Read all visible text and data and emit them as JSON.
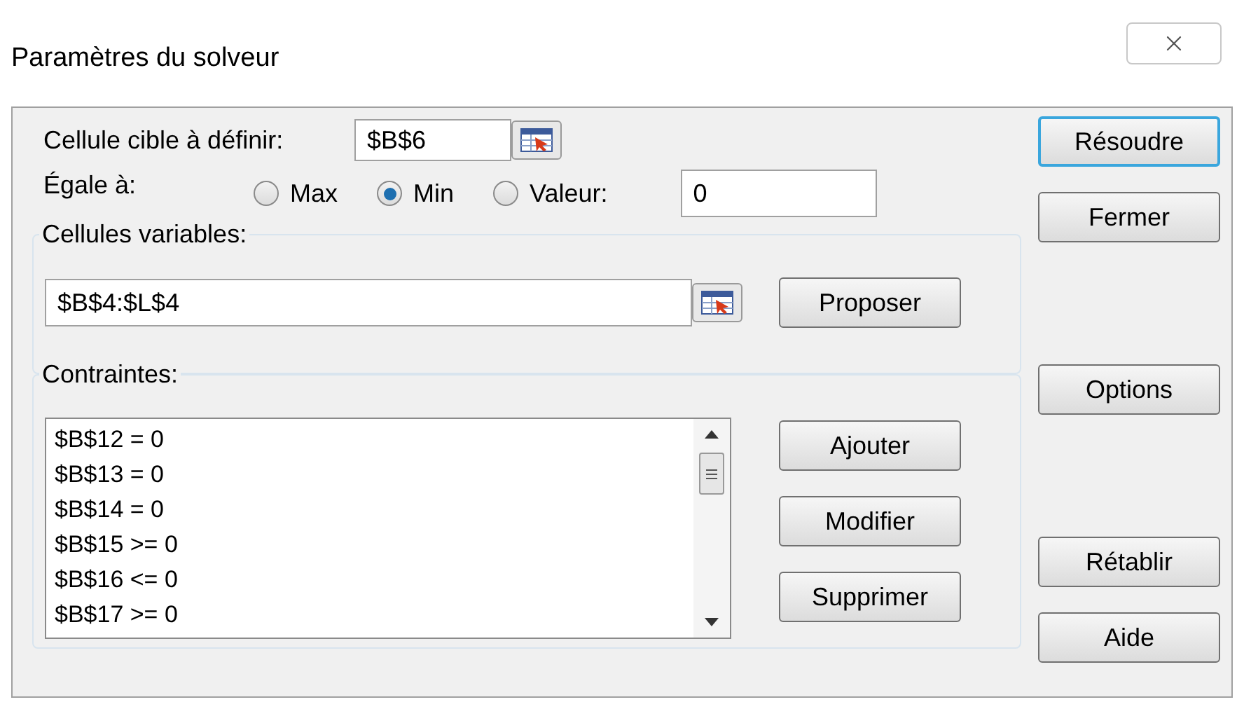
{
  "window": {
    "title": "Paramètres du solveur"
  },
  "target": {
    "label": "Cellule cible à définir:",
    "value": "$B$6"
  },
  "equal_to": {
    "label": "Égale à:",
    "options": [
      {
        "label": "Max",
        "selected": false
      },
      {
        "label": "Min",
        "selected": true
      },
      {
        "label": "Valeur:",
        "selected": false
      }
    ],
    "value": "0"
  },
  "variable_cells": {
    "label": "Cellules variables:",
    "value": "$B$4:$L$4",
    "button": "Proposer"
  },
  "constraints": {
    "label": "Contraintes:",
    "items": [
      "$B$12 = 0",
      "$B$13 = 0",
      "$B$14 = 0",
      "$B$15 >= 0",
      "$B$16 <= 0",
      "$B$17 >= 0"
    ],
    "buttons": [
      "Ajouter",
      "Modifier",
      "Supprimer"
    ]
  },
  "side_buttons": [
    {
      "label": "Résoudre",
      "focused": true
    },
    {
      "label": "Fermer",
      "focused": false
    },
    {
      "label": "Options",
      "focused": false
    },
    {
      "label": "Rétablir",
      "focused": false
    },
    {
      "label": "Aide",
      "focused": false
    }
  ]
}
